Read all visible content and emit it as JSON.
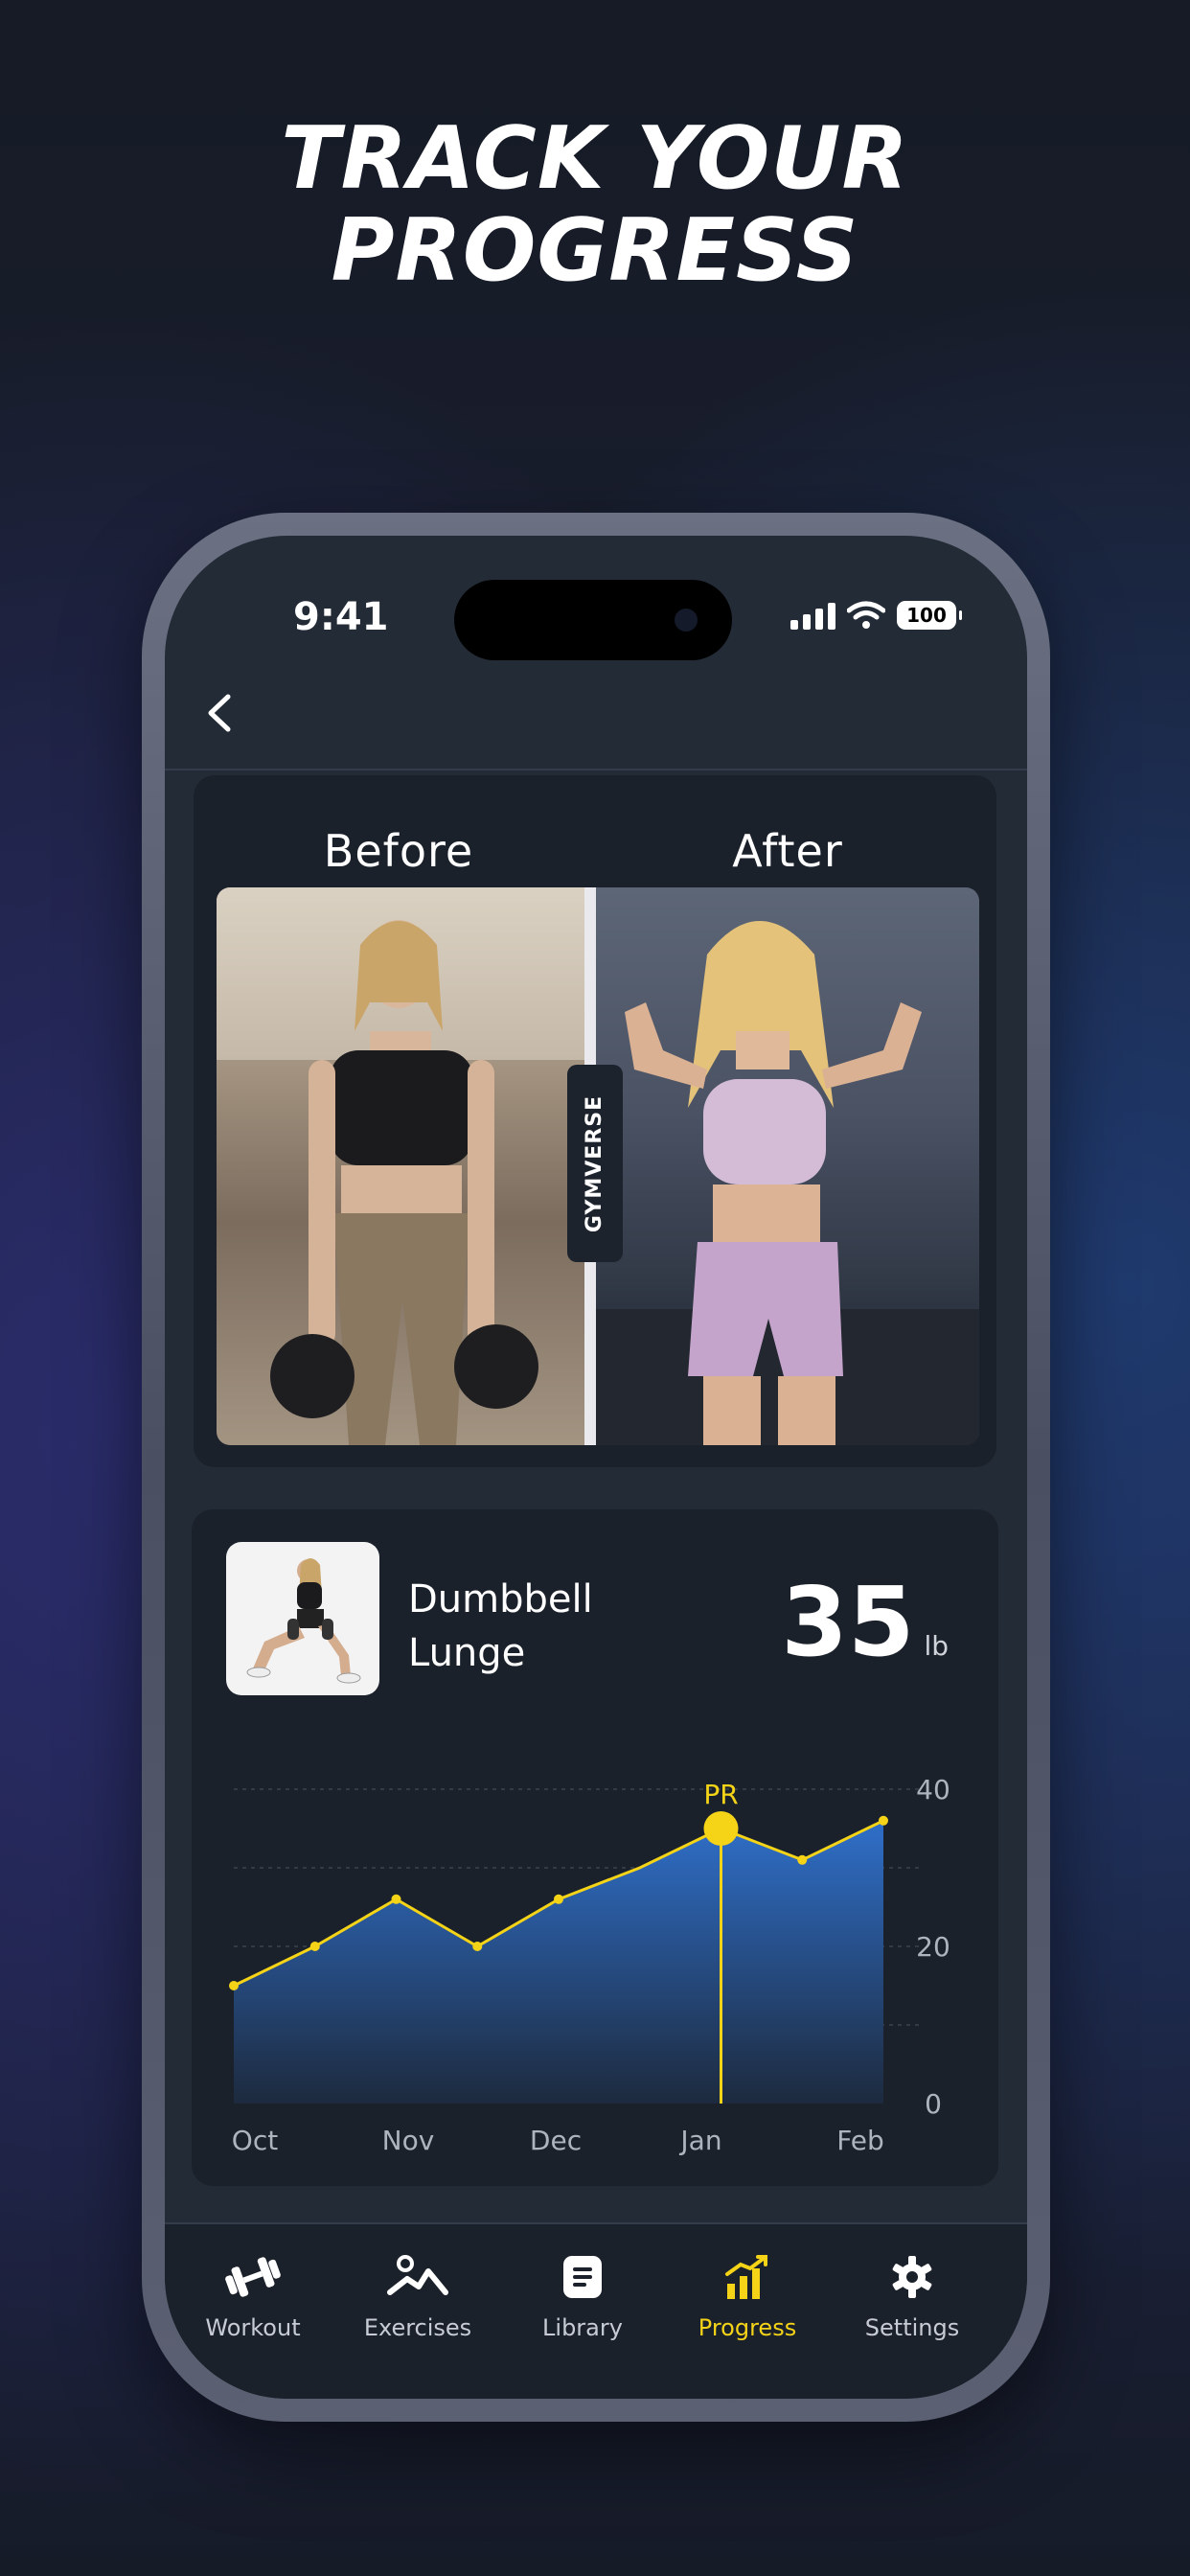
{
  "headline": {
    "line1": "TRACK YOUR",
    "line2": "PROGRESS"
  },
  "status_bar": {
    "time": "9:41",
    "battery": "100"
  },
  "comparison": {
    "before_label": "Before",
    "after_label": "After",
    "brand": "GYMVERSE"
  },
  "exercise": {
    "name_line1": "Dumbbell",
    "name_line2": "Lunge",
    "weight": "35",
    "unit": "lb"
  },
  "chart_data": {
    "type": "area",
    "x": [
      "Oct",
      "Oct-2",
      "Nov",
      "Nov-2",
      "Dec",
      "Dec-2",
      "Jan",
      "Jan-2",
      "Feb"
    ],
    "xtick_labels": [
      "Oct",
      "Nov",
      "Dec",
      "Jan",
      "Feb"
    ],
    "values": [
      15,
      20,
      26,
      20,
      26,
      30,
      35,
      31,
      36
    ],
    "ylim": [
      0,
      40
    ],
    "ytick_labels": [
      "40",
      "20",
      "0"
    ],
    "annotation": {
      "label": "PR",
      "index": 6
    },
    "grid": true,
    "colors": {
      "line": "#f5d418",
      "fill": "#2f6fc9"
    }
  },
  "tabs": [
    {
      "label": "Workout",
      "icon": "dumbbell-icon",
      "active": false
    },
    {
      "label": "Exercises",
      "icon": "exercises-icon",
      "active": false
    },
    {
      "label": "Library",
      "icon": "library-icon",
      "active": false
    },
    {
      "label": "Progress",
      "icon": "progress-chart-icon",
      "active": true
    },
    {
      "label": "Settings",
      "icon": "gear-icon",
      "active": false
    }
  ],
  "colors": {
    "accent": "#f5d418",
    "card": "#1b212b",
    "screen": "#232b36"
  }
}
